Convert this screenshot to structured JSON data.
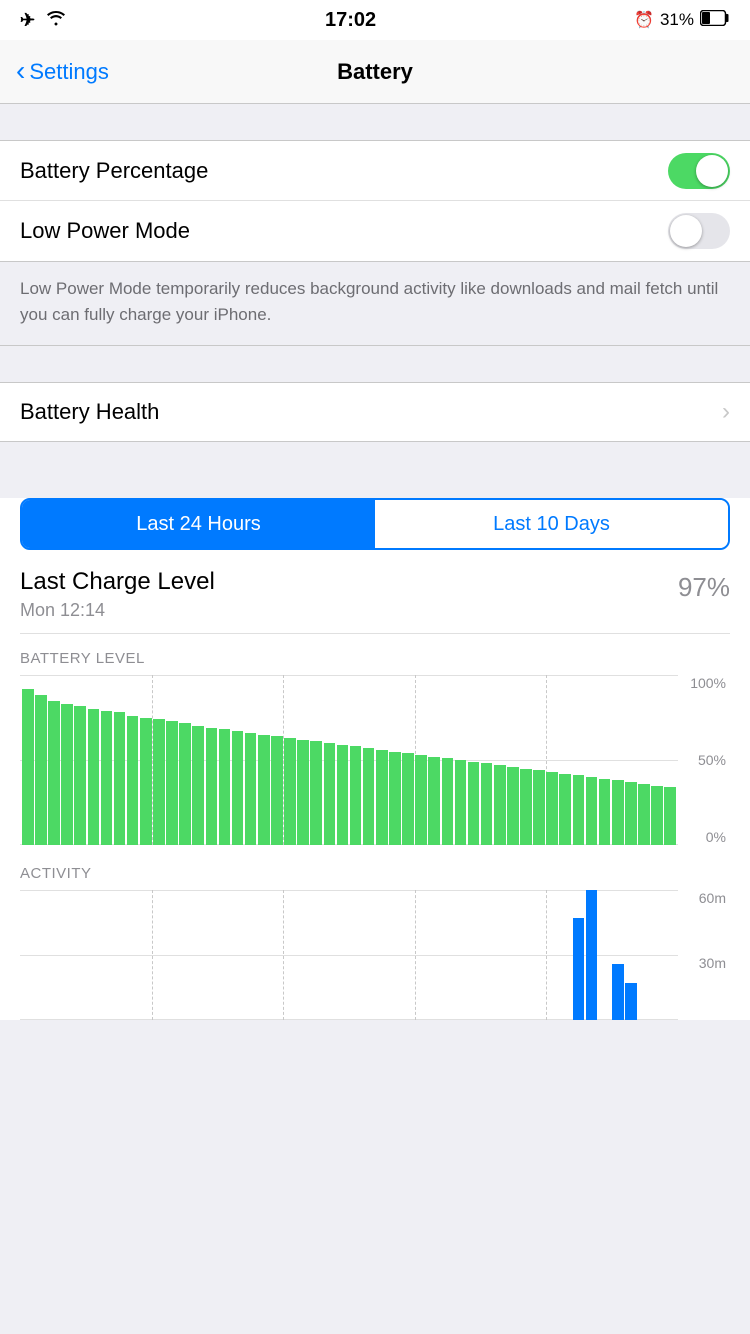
{
  "statusBar": {
    "time": "17:02",
    "battery": "31%",
    "icons": {
      "airplane": "✈",
      "wifi": "wifi-icon",
      "alarm": "⏰"
    }
  },
  "navBar": {
    "backLabel": "Settings",
    "title": "Battery"
  },
  "settings": {
    "batteryPercentageLabel": "Battery Percentage",
    "batteryPercentageEnabled": true,
    "lowPowerModeLabel": "Low Power Mode",
    "lowPowerModeEnabled": false,
    "lowPowerDescription": "Low Power Mode temporarily reduces background activity like downloads and mail fetch until you can fully charge your iPhone.",
    "batteryHealthLabel": "Battery Health",
    "batteryHealthChevron": "›"
  },
  "usage": {
    "segmented": {
      "last24HoursLabel": "Last 24 Hours",
      "last10DaysLabel": "Last 10 Days"
    },
    "lastCharge": {
      "title": "Last Charge Level",
      "time": "Mon 12:14",
      "percentage": "97%"
    },
    "batteryLevelLabel": "BATTERY LEVEL",
    "yLabels": [
      "100%",
      "50%",
      "0%"
    ],
    "activityLabel": "ACTIVITY",
    "activityYLabels": [
      "60m",
      "30m",
      ""
    ],
    "bars": [
      92,
      88,
      85,
      83,
      82,
      80,
      79,
      78,
      76,
      75,
      74,
      73,
      72,
      70,
      69,
      68,
      67,
      66,
      65,
      64,
      63,
      62,
      61,
      60,
      59,
      58,
      57,
      56,
      55,
      54,
      53,
      52,
      51,
      50,
      49,
      48,
      47,
      46,
      45,
      44,
      43,
      42,
      41,
      40,
      39,
      38,
      37,
      36,
      35,
      34
    ],
    "activityBarsData": [
      0,
      0,
      0,
      0,
      0,
      0,
      0,
      0,
      0,
      0,
      0,
      0,
      0,
      0,
      0,
      0,
      0,
      0,
      0,
      0,
      0,
      0,
      0,
      0,
      0,
      0,
      0,
      0,
      0,
      0,
      0,
      0,
      0,
      0,
      0,
      0,
      0,
      0,
      0,
      0,
      0,
      0,
      55,
      70,
      0,
      30,
      20,
      0,
      0,
      0
    ]
  }
}
